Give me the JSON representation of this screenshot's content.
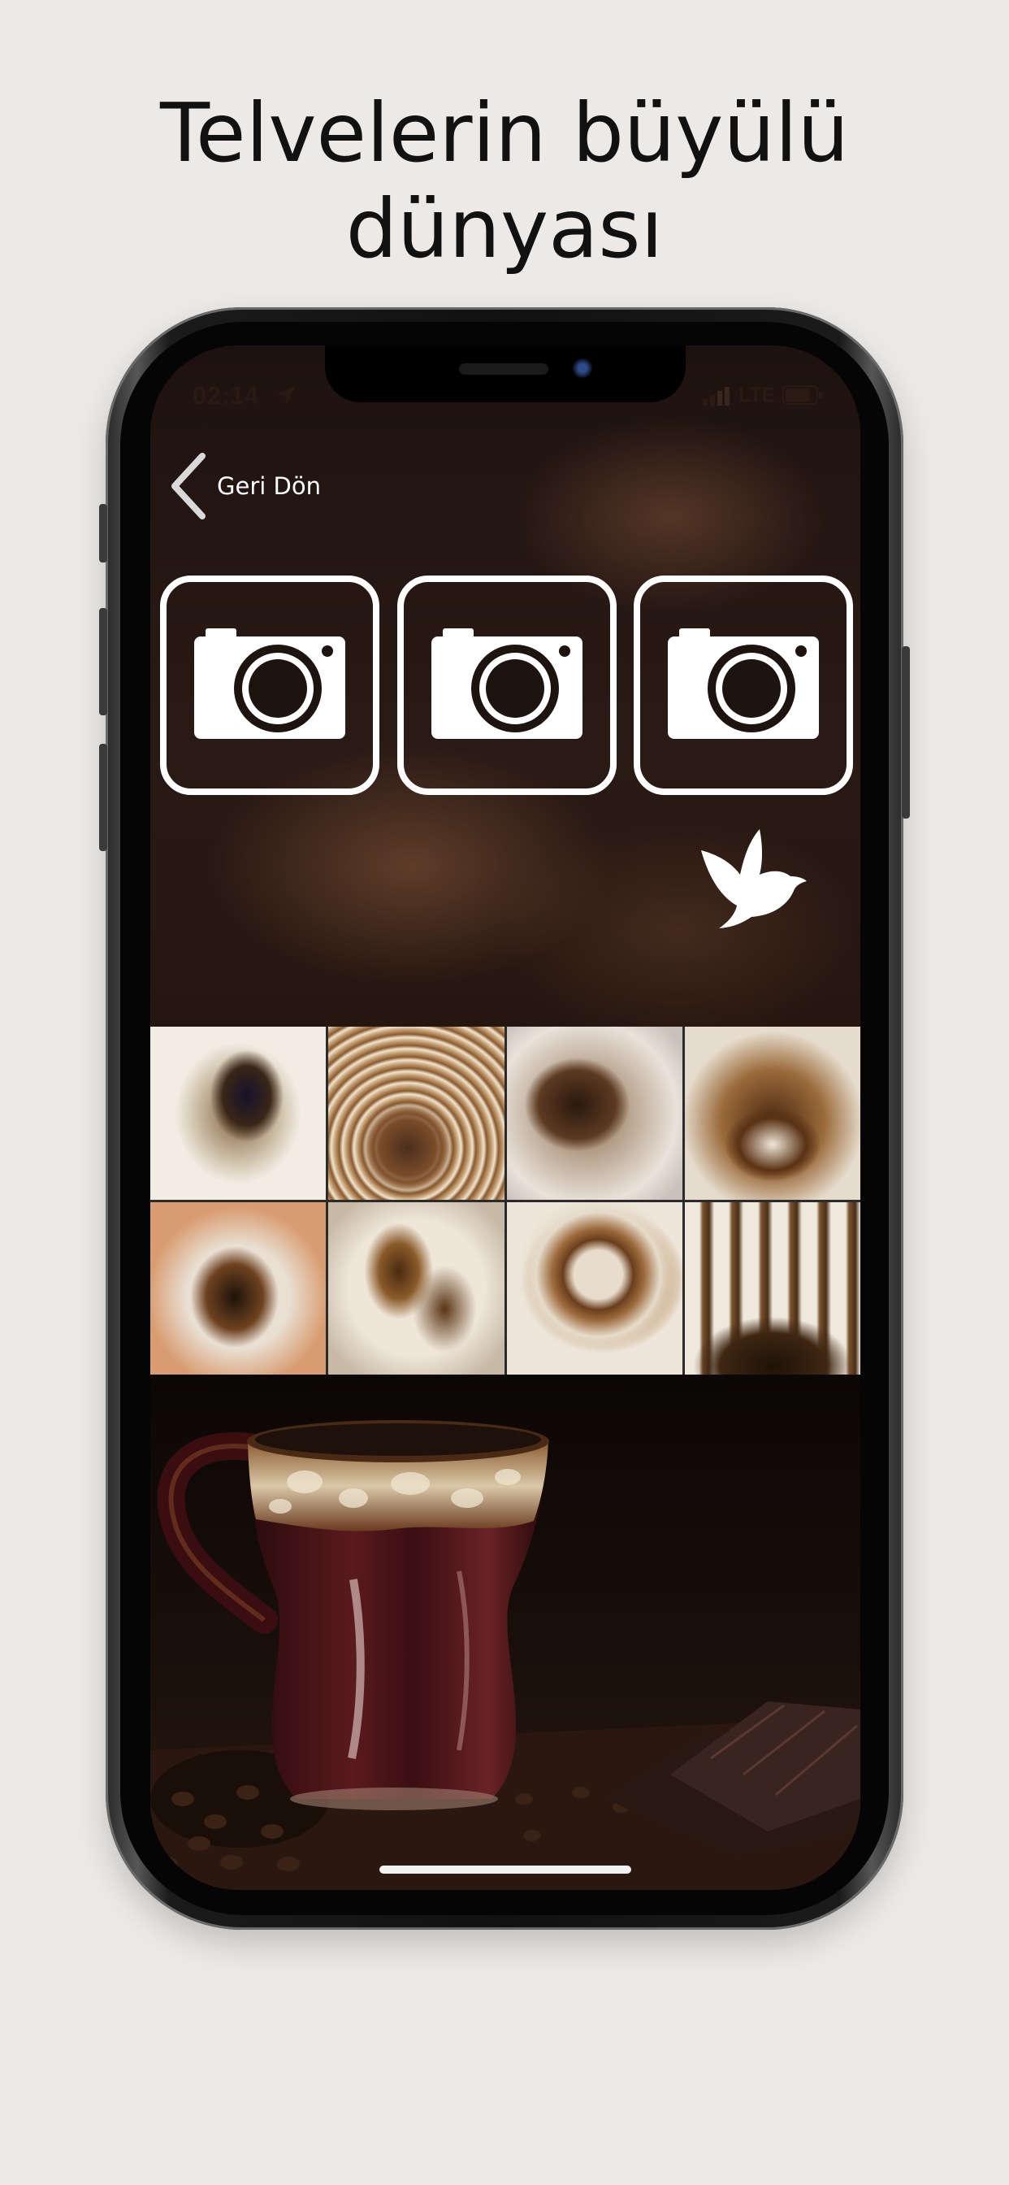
{
  "headline": {
    "line1": "Telvelerin büyülü",
    "line2": "dünyası"
  },
  "status_bar": {
    "time": "02:14",
    "network": "LTE",
    "location_icon": "location-arrow-icon",
    "signal_icon": "signal-bars-icon",
    "battery_icon": "battery-icon"
  },
  "navigation": {
    "back_label": "Geri Dön",
    "back_icon": "chevron-left-icon"
  },
  "camera_slots": [
    {
      "icon": "camera-icon"
    },
    {
      "icon": "camera-icon"
    },
    {
      "icon": "camera-icon"
    }
  ],
  "send_icon": "dove-icon",
  "sample_photos": [
    "coffee-grounds-cup-1",
    "coffee-grounds-cup-2",
    "coffee-grounds-cup-3",
    "coffee-grounds-cup-4",
    "coffee-grounds-cup-5",
    "coffee-grounds-cup-6",
    "coffee-grounds-cup-7",
    "coffee-grounds-cup-8"
  ],
  "colors": {
    "page_background": "#ede9e6",
    "headline_text": "#111111",
    "screen_background": "#1e1210",
    "icon_white": "#ffffff"
  }
}
